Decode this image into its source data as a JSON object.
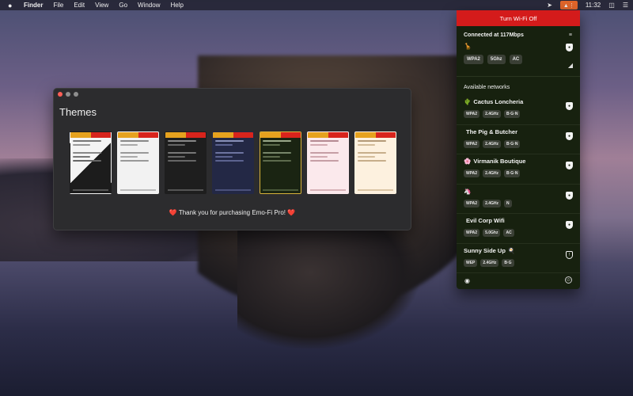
{
  "menubar": {
    "apple": "",
    "items": [
      "Finder",
      "File",
      "Edit",
      "View",
      "Go",
      "Window",
      "Help"
    ],
    "location_icon": "location-arrow-icon",
    "app_status_icon": "emo-fi-status-icon",
    "cast_icon": "airplay-icon",
    "time": "11:32",
    "control_icon": "control-center-icon",
    "list_icon": "notification-list-icon"
  },
  "themes_window": {
    "title": "Themes",
    "thanks_message": "❤️ Thank you for purchasing Emo-Fi Pro! ❤️",
    "theme_count": 7,
    "selected_index": 4
  },
  "wifi_panel": {
    "turn_off_label": "Turn Wi-Fi Off",
    "accent": "#d41b1b",
    "background": "#17210f",
    "connected": {
      "title": "Connected at 117Mbps",
      "emoji": "🦒",
      "tags": [
        "WPA2",
        "5Ghz",
        "AC"
      ]
    },
    "available_label": "Available networks",
    "networks": [
      {
        "emoji": "🌵",
        "name": "Cactus Loncheria",
        "tags": [
          "WPA2",
          "2.4GHz",
          "B·G·N"
        ],
        "secured": true
      },
      {
        "emoji": "",
        "name": "The Pig & Butcher",
        "tags": [
          "WPA2",
          "2.4GHz",
          "B·G·N"
        ],
        "secured": true
      },
      {
        "emoji": "🌸",
        "name": "Virmanik Boutique",
        "tags": [
          "WPA2",
          "2.4GHz",
          "B·G·N"
        ],
        "secured": true
      },
      {
        "emoji": "🦄",
        "name": "",
        "tags": [
          "WPA2",
          "2.4GHz",
          "N"
        ],
        "secured": true
      },
      {
        "emoji": "",
        "name": "Evil Corp Wifi",
        "tags": [
          "WPA2",
          "5.0Ghz",
          "AC"
        ],
        "secured": true
      },
      {
        "emoji": "🍳",
        "name": "Sunny Side Up",
        "tags": [
          "WEP",
          "2.4GHz",
          "B·G"
        ],
        "secured": false
      }
    ]
  }
}
